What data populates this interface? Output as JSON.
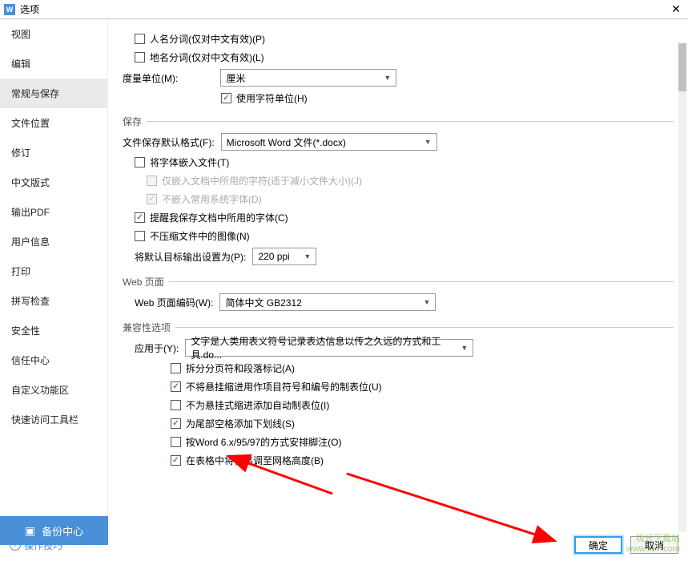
{
  "title": "选项",
  "sidebar": {
    "items": [
      {
        "label": "视图"
      },
      {
        "label": "编辑"
      },
      {
        "label": "常规与保存"
      },
      {
        "label": "文件位置"
      },
      {
        "label": "修订"
      },
      {
        "label": "中文版式"
      },
      {
        "label": "输出PDF"
      },
      {
        "label": "用户信息"
      },
      {
        "label": "打印"
      },
      {
        "label": "拼写检查"
      },
      {
        "label": "安全性"
      },
      {
        "label": "信任中心"
      },
      {
        "label": "自定义功能区"
      },
      {
        "label": "快速访问工具栏"
      }
    ]
  },
  "general": {
    "nameNoun": "人名分词(仅对中文有效)(P)",
    "placeNoun": "地名分词(仅对中文有效)(L)",
    "unitLabel": "度量单位(M):",
    "unitSelect": "厘米",
    "useCharUnit": "使用字符单位(H)"
  },
  "save": {
    "header": "保存",
    "defaultFmtLabel": "文件保存默认格式(F):",
    "defaultFmt": "Microsoft Word 文件(*.docx)",
    "embedFont": "将字体嵌入文件(T)",
    "embedOnlyUsed": "仅嵌入文档中所用的字符(适于减小文件大小)(J)",
    "notEmbedSys": "不嵌入常用系统字体(D)",
    "remindFont": "提醒我保存文档中所用的字体(C)",
    "noCompressImg": "不压缩文件中的图像(N)",
    "defaultResLabel": "将默认目标输出设置为(P):",
    "defaultRes": "220 ppi"
  },
  "web": {
    "header": "Web 页面",
    "encodingLabel": "Web 页面编码(W):",
    "encoding": "简体中文 GB2312"
  },
  "compat": {
    "header": "兼容性选项",
    "applyToLabel": "应用于(Y):",
    "applyTo": "文字是人类用表义符号记录表达信息以传之久远的方式和工具.do...",
    "opts": [
      {
        "label": "拆分分页符和段落标记(A)",
        "checked": false
      },
      {
        "label": "不将悬挂缩进用作项目符号和编号的制表位(U)",
        "checked": true
      },
      {
        "label": "不为悬挂式缩进添加自动制表位(I)",
        "checked": false
      },
      {
        "label": "为尾部空格添加下划线(S)",
        "checked": true
      },
      {
        "label": "按Word 6.x/95/97的方式安排脚注(O)",
        "checked": false
      },
      {
        "label": "在表格中将行高调至网格高度(B)",
        "checked": true
      }
    ]
  },
  "backupBtn": "备份中心",
  "helpLink": "操作技巧",
  "buttons": {
    "ok": "确定",
    "cancel": "取消"
  },
  "watermark": {
    "l1": "极光下载站",
    "l2": "www.xz7.com"
  }
}
